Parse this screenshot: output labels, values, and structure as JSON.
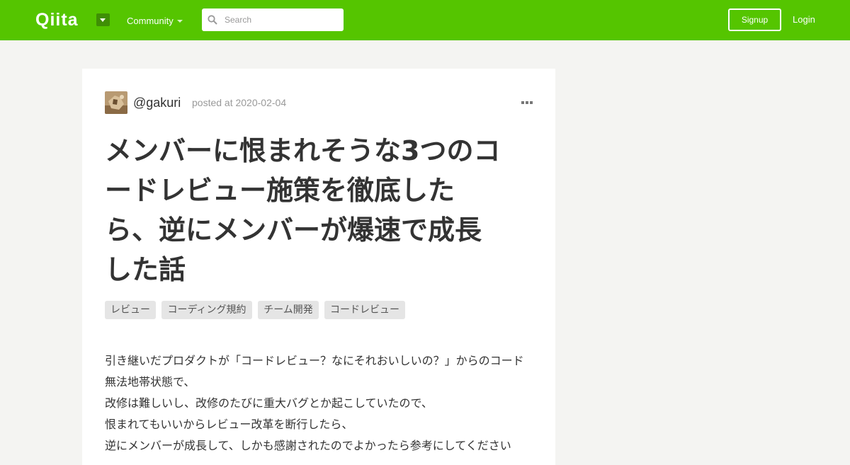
{
  "header": {
    "logo": "Qiita",
    "menu": "Community",
    "search_placeholder": "Search",
    "signup": "Signup",
    "login": "Login"
  },
  "article": {
    "author": "@gakuri",
    "posted": "posted at 2020-02-04",
    "title_lines": [
      "メンバーに恨まれそうな3つのコ",
      "ードレビュー施策を徹底した",
      "ら、逆にメンバーが爆速で成長",
      "した話"
    ],
    "tags": [
      "レビュー",
      "コーディング規約",
      "チーム開発",
      "コードレビュー"
    ],
    "body_lines": [
      "引き継いだプロダクトが「コードレビュー？なにそれおいしいの？」からのコード",
      "無法地帯状態で、",
      "改修は難しいし、改修のたびに重大バグとか起こしていたので、",
      "恨まれてもいいからレビュー改革を断行したら、",
      "逆にメンバーが成長して、しかも感謝されたのでよかったら参考にしてください"
    ]
  },
  "colors": {
    "brand": "#55c500",
    "page_bg": "#f4f4f2"
  },
  "icons": [
    "qiita-logo",
    "dropdown-caret-icon",
    "search-icon",
    "avatar-image",
    "more-options-icon"
  ]
}
